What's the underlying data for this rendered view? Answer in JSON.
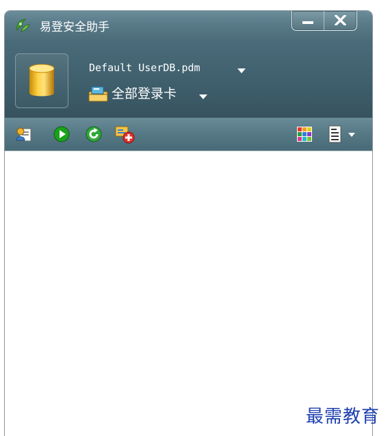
{
  "window": {
    "title": "易登安全助手"
  },
  "titlebar_buttons": {
    "minimize_icon": "minimize-icon",
    "close_icon": "close-icon"
  },
  "header": {
    "db_icon": "database-cylinder-icon",
    "db_file": "Default UserDB.pdm",
    "category_icon": "card-folder-icon",
    "category": "全部登录卡"
  },
  "toolbar": {
    "left": [
      "user-manage-icon",
      "play-icon",
      "refresh-icon",
      "add-card-icon"
    ],
    "right": [
      "color-grid-icon",
      "view-list-icon"
    ]
  },
  "colors": {
    "titlebar": "#5a7c8a",
    "header": "#3f5f6d",
    "toolbar": "#567a86",
    "watermark": "#1e3fb0"
  },
  "watermark": "最需教育"
}
